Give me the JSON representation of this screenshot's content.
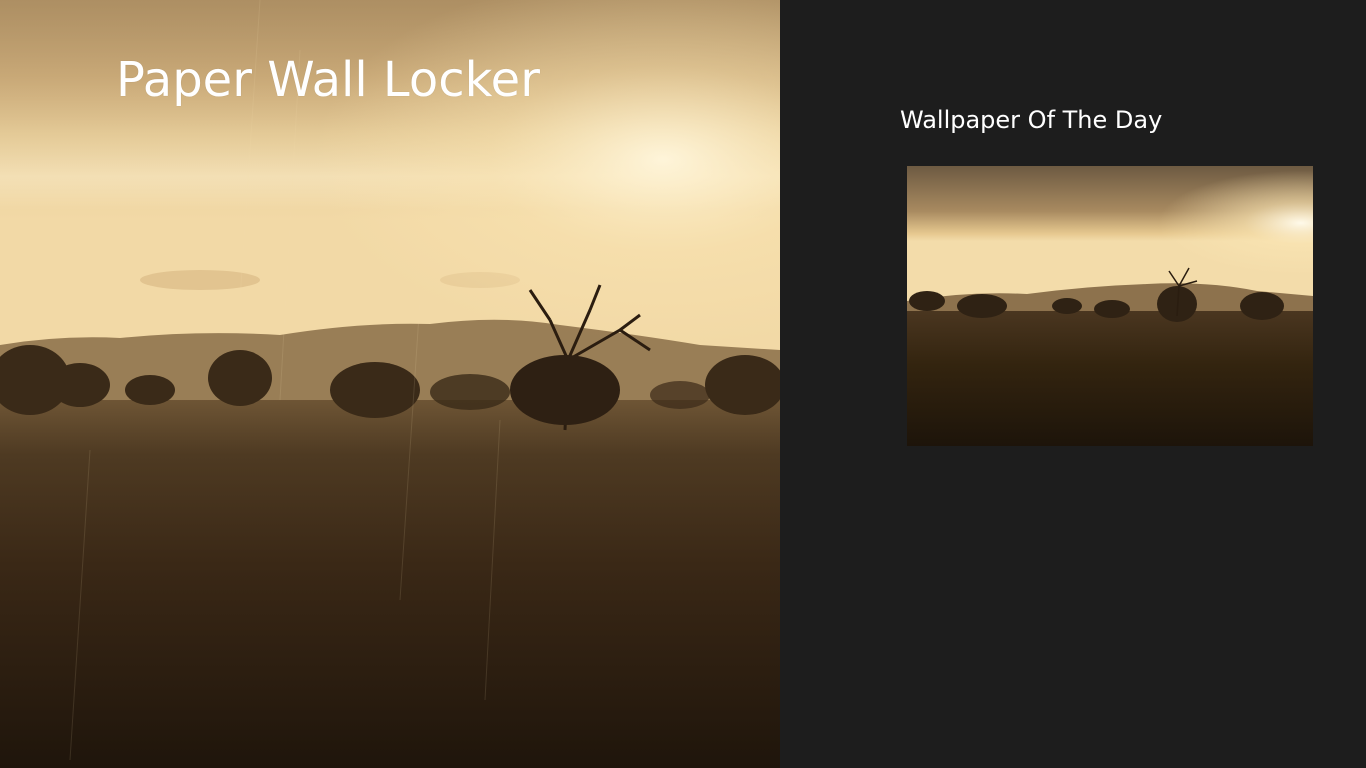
{
  "app": {
    "title": "Paper Wall Locker"
  },
  "hero": {
    "image": "rainy-meadow-sunset-wallpaper"
  },
  "side_panel": {
    "section_title": "Wallpaper Of The Day",
    "thumbnail_image": "rainy-meadow-sunset-wallpaper"
  },
  "colors": {
    "background": "#1d1d1d",
    "text": "#ffffff",
    "sky_light": "#fbe6b4",
    "sky_warm": "#e6c58c",
    "grass_dark": "#2a1c10"
  }
}
